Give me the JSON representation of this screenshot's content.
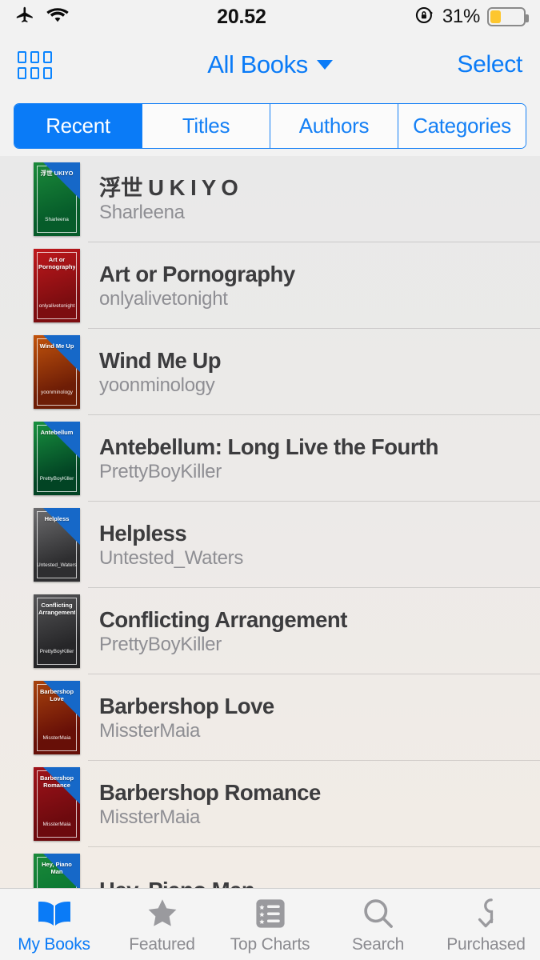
{
  "status_bar": {
    "airplane_icon": "airplane-mode-icon",
    "wifi_icon": "wifi-icon",
    "time": "20.52",
    "rotation_lock_icon": "rotation-lock-icon",
    "battery_percent": "31%",
    "battery_level": 31,
    "battery_color": "#fdc62e"
  },
  "nav_bar": {
    "grid_icon": "grid-view-icon",
    "title": "All Books",
    "dropdown_icon": "chevron-down-icon",
    "right_action": "Select",
    "accent_color": "#0a7bf7"
  },
  "segmented_control": {
    "selected_index": 0,
    "segments": [
      {
        "label": "Recent"
      },
      {
        "label": "Titles"
      },
      {
        "label": "Authors"
      },
      {
        "label": "Categories"
      }
    ]
  },
  "books": [
    {
      "title": "浮世 U K I Y O",
      "author": "Sharleena",
      "cover_title": "浮世 UKIYO",
      "cover_author": "Sharleena",
      "cover_color_top": "#1b8a3a",
      "cover_color_bottom": "#065c2a",
      "has_corner": true
    },
    {
      "title": "Art or Pornography",
      "author": "onlyalivetonight",
      "cover_title": "Art or Pornography",
      "cover_author": "onlyalivetonight",
      "cover_color_top": "#c0181c",
      "cover_color_bottom": "#7d0d10",
      "has_corner": false
    },
    {
      "title": "Wind Me Up",
      "author": "yoonminology",
      "cover_title": "Wind Me Up",
      "cover_author": "yoonminology",
      "cover_color_top": "#c2540c",
      "cover_color_bottom": "#6e1d06",
      "has_corner": true
    },
    {
      "title": "Antebellum: Long Live the Fourth",
      "author": "PrettyBoyKiller",
      "cover_title": "Antebellum",
      "cover_author": "PrettyBoyKiller",
      "cover_color_top": "#18913f",
      "cover_color_bottom": "#024424",
      "has_corner": true
    },
    {
      "title": "Helpless",
      "author": "Untested_Waters",
      "cover_title": "Helpless",
      "cover_author": "Untested_Waters",
      "cover_color_top": "#6e6e70",
      "cover_color_bottom": "#2e2e30",
      "has_corner": true
    },
    {
      "title": "Conflicting Arrangement",
      "author": "PrettyBoyKiller",
      "cover_title": "Conflicting Arrangement",
      "cover_author": "PrettyBoyKiller",
      "cover_color_top": "#555557",
      "cover_color_bottom": "#262628",
      "has_corner": false
    },
    {
      "title": "Barbershop Love",
      "author": "MissterMaia",
      "cover_title": "Barbershop Love",
      "cover_author": "MissterMaia",
      "cover_color_top": "#a8430d",
      "cover_color_bottom": "#670f07",
      "has_corner": true
    },
    {
      "title": "Barbershop Romance",
      "author": "MissterMaia",
      "cover_title": "Barbershop Romance",
      "cover_author": "MissterMaia",
      "cover_color_top": "#a0131a",
      "cover_color_bottom": "#6d0a0e",
      "has_corner": true
    },
    {
      "title": "Hey, Piano Man",
      "author": "",
      "cover_title": "Hey, Piano Man",
      "cover_author": "",
      "cover_color_top": "#1b8a3a",
      "cover_color_bottom": "#077230",
      "has_corner": true
    }
  ],
  "tab_bar": {
    "selected_index": 0,
    "tabs": [
      {
        "label": "My Books",
        "icon": "open-book-icon"
      },
      {
        "label": "Featured",
        "icon": "star-icon"
      },
      {
        "label": "Top Charts",
        "icon": "chart-list-icon"
      },
      {
        "label": "Search",
        "icon": "search-icon"
      },
      {
        "label": "Purchased",
        "icon": "download-hook-icon"
      }
    ]
  }
}
